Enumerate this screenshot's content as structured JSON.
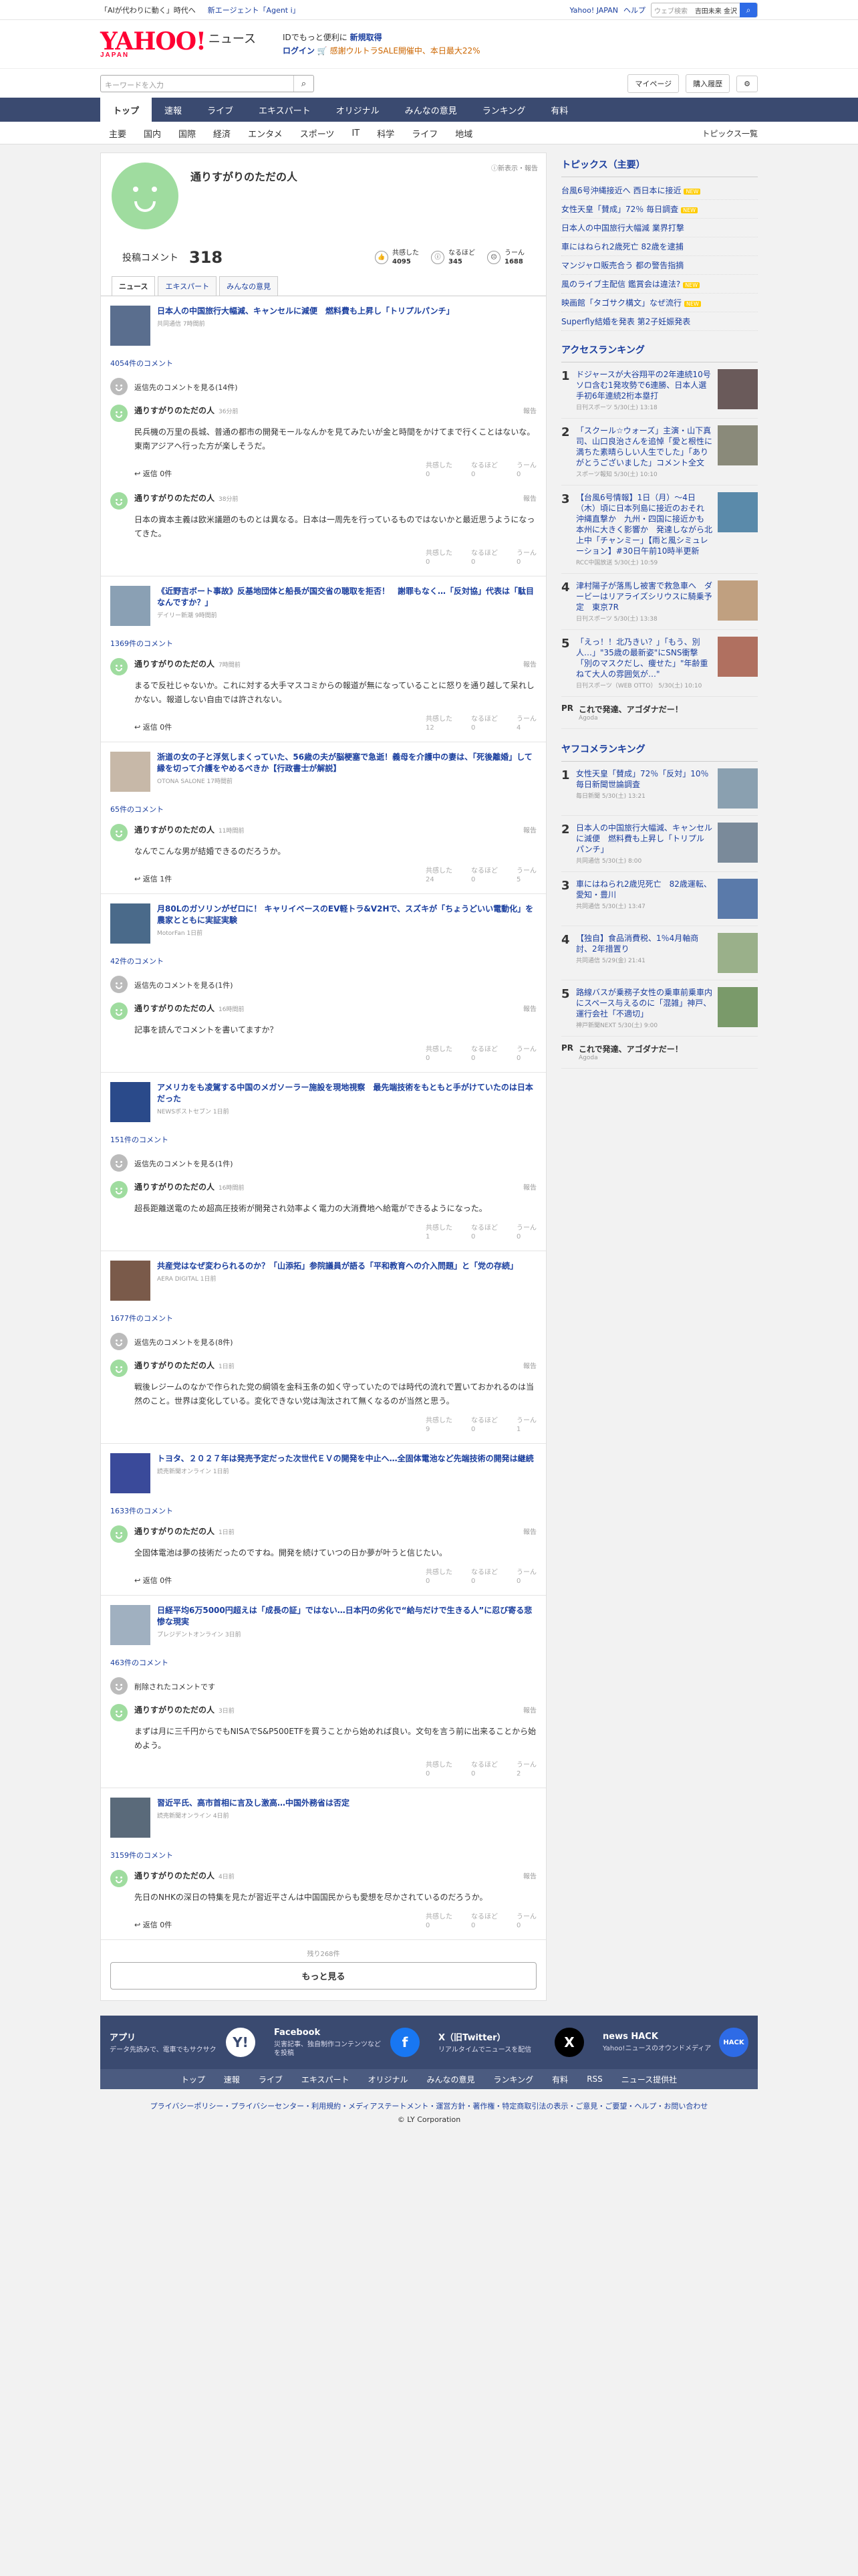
{
  "topbar": {
    "promo1": "「AIが代わりに動く」時代へ",
    "promo2": "新エージェント「Agent i」",
    "links": [
      "Yahoo! JAPAN",
      "ヘルプ"
    ],
    "search_placeholder": "ウェブ検索",
    "location": "吉田未来 金沢"
  },
  "header": {
    "logo": "YAHOO!",
    "logo_sub": "JAPAN",
    "logo_section": "ニュース",
    "promo_line1_a": "IDでもっと便利に",
    "promo_line1_b": "新規取得",
    "promo_line2_a": "ログイン",
    "promo_line2_b": "🛒 感謝ウルトラSALE開催中、本日最大22%"
  },
  "search": {
    "placeholder": "キーワードを入力",
    "mypage": "マイページ",
    "history": "購入履歴"
  },
  "gnav": [
    "トップ",
    "速報",
    "ライブ",
    "エキスパート",
    "オリジナル",
    "みんなの意見",
    "ランキング",
    "有料"
  ],
  "subnav": [
    "主要",
    "国内",
    "国際",
    "経済",
    "エンタメ",
    "スポーツ",
    "IT",
    "科学",
    "ライフ",
    "地域"
  ],
  "subnav_more": "トピックス一覧",
  "profile": {
    "name": "通りすがりのただの人",
    "links": "ⓘ新表示・報告",
    "comments_label": "投稿コメント",
    "comments_count": "318",
    "stats": [
      {
        "label": "共感した",
        "value": "4095",
        "icon": "👍"
      },
      {
        "label": "なるほど",
        "value": "345",
        "icon": "ⓘ"
      },
      {
        "label": "うーん",
        "value": "1688",
        "icon": "☹"
      }
    ]
  },
  "tabs": [
    "ニュース",
    "エキスパート",
    "みんなの意見"
  ],
  "articles": [
    {
      "title": "日本人の中国旅行大幅減、キャンセルに減便　燃料費も上昇し「トリプルパンチ」",
      "source": "共同通信 7時間前",
      "comment_count": "4054件のコメント",
      "comments": [
        {
          "name": "通りすがりのただの人",
          "date": "36分前",
          "text": "民兵機の万里の長城、普通の都市の開発モールなんかを見てみたいが金と時間をかけてまで行くことはないな。東南アジアへ行った方が楽しそうだ。",
          "reply": "返信 0件",
          "a": "0",
          "b": "0",
          "c": "0"
        },
        {
          "name": "通りすがりのただの人",
          "date": "38分前",
          "text": "日本の資本主義は欧米議題のものとは異なる。日本は一周先を行っているものではないかと最近思うようになってきた。",
          "reply": "",
          "a": "0",
          "b": "0",
          "c": "0"
        }
      ],
      "hidden": "返信先のコメントを見る(14件)"
    },
    {
      "title": "《近野吉ボート事故》反基地団体と船長が国交省の聴取を拒否！　謝罪もなく…「反対協」代表は「駄目なんですか？」",
      "source": "デイリー新潮 9時間前",
      "comment_count": "1369件のコメント",
      "comments": [
        {
          "name": "通りすがりのただの人",
          "date": "7時間前",
          "text": "まるで反社じゃないか。これに対する大手マスコミからの報道が無になっていることに怒りを通り越して呆れしかない。報道しない自由では許されない。",
          "reply": "返信 0件",
          "a": "12",
          "b": "0",
          "c": "4"
        }
      ],
      "hidden": ""
    },
    {
      "title": "浙道の女の子と浮気しまくっていた、56歳の夫が脳梗塞で急逝！義母を介護中の妻は、「死後離婚」して縁を切って介護をやめるべきか【行政書士が解説】",
      "source": "OTONA SALONE 17時間前",
      "comment_count": "65件のコメント",
      "comments": [
        {
          "name": "通りすがりのただの人",
          "date": "11時間前",
          "text": "なんでこんな男が結婚できるのだろうか。",
          "reply": "返信 1件",
          "a": "24",
          "b": "0",
          "c": "5"
        }
      ],
      "hidden": ""
    },
    {
      "title": "月80Lのガソリンがゼロに！ キャリイベースのEV軽トラ&V2Hで、スズキが「ちょうどいい電動化」を農家とともに実証実験",
      "source": "MotorFan 1日前",
      "comment_count": "42件のコメント",
      "comments": [
        {
          "name": "通りすがりのただの人",
          "date": "16時間前",
          "text": "記事を読んでコメントを書いてますか？",
          "reply": "",
          "a": "0",
          "b": "0",
          "c": "0"
        }
      ],
      "hidden": "返信先のコメントを見る(1件)"
    },
    {
      "title": "アメリカをも凌駕する中国のメガソーラー施設を現地視察　最先端技術をもともと手がけていたのは日本だった",
      "source": "NEWSポストセブン 1日前",
      "comment_count": "151件のコメント",
      "comments": [
        {
          "name": "通りすがりのただの人",
          "date": "16時間前",
          "text": "超長距離送電のため超高圧技術が開発され効率よく電力の大消費地へ給電ができるようになった。",
          "reply": "",
          "a": "1",
          "b": "0",
          "c": "0"
        }
      ],
      "hidden": "返信先のコメントを見る(1件)"
    },
    {
      "title": "共産党はなぜ変わられるのか？「山添拓」参院議員が語る「平和教育への介入問題」と「党の存続」",
      "source": "AERA DIGITAL 1日前",
      "comment_count": "1677件のコメント",
      "comments": [
        {
          "name": "通りすがりのただの人",
          "date": "1日前",
          "text": "戦後レジームのなかで作られた党の綱領を金科玉条の如く守っていたのでは時代の流れで置いておかれるのは当然のこと。世界は変化している。変化できない党は淘汰されて無くなるのが当然と思う。",
          "reply": "",
          "a": "9",
          "b": "0",
          "c": "1"
        }
      ],
      "hidden": "返信先のコメントを見る(8件)"
    },
    {
      "title": "トヨタ、２０２７年は発売予定だった次世代ＥＶの開発を中止へ…全固体電池など先端技術の開発は継続",
      "source": "読売新聞オンライン 1日前",
      "comment_count": "1633件のコメント",
      "comments": [
        {
          "name": "通りすがりのただの人",
          "date": "1日前",
          "text": "全固体電池は夢の技術だったのですね。開発を続けていつの日か夢が叶うと信じたい。",
          "reply": "返信 0件",
          "a": "0",
          "b": "0",
          "c": "0"
        }
      ],
      "hidden": ""
    },
    {
      "title": "日経平均6万5000円超えは「成長の証」ではない…日本円の劣化で“給与だけで生きる人”に忍び寄る悲惨な現実",
      "source": "プレジデントオンライン 3日前",
      "comment_count": "463件のコメント",
      "comments": [
        {
          "name": "通りすがりのただの人",
          "date": "3日前",
          "text": "まずは月に三千円からでもNISAでS&P500ETFを買うことから始めれば良い。文句を言う前に出来ることから始めよう。",
          "reply": "",
          "a": "0",
          "b": "0",
          "c": "2"
        }
      ],
      "hidden": "削除されたコメントです"
    },
    {
      "title": "習近平氏、高市首相に言及し激高…中国外務省は否定",
      "source": "読売新聞オンライン 4日前",
      "comment_count": "3159件のコメント",
      "comments": [
        {
          "name": "通りすがりのただの人",
          "date": "4日前",
          "text": "先日のNHKの深日の特集を見たが習近平さんは中国国民からも愛想を尽かされているのだろうか。",
          "reply": "返信 0件",
          "a": "0",
          "b": "0",
          "c": "0"
        }
      ],
      "hidden": ""
    }
  ],
  "reaction_labels": [
    "共感した",
    "なるほど",
    "うーん"
  ],
  "report": "報告",
  "remaining": "残り268件",
  "more_button": "もっと見る",
  "side": {
    "topics_title": "トピックス（主要）",
    "topics": [
      "台風6号沖縄接近へ 西日本に接近",
      "女性天皇「賛成」72％ 毎日調査",
      "日本人の中国旅行大幅減 業界打撃",
      "車にはねられ2歳死亡 82歳を逮捕",
      "マンジャロ販売合う 都の警告指摘",
      "風のライブ主配信 鑑賞会は違法?",
      "映画館「タゴサク構文」なぜ流行",
      "Superfly結婚を発表 第2子妊娠発表"
    ],
    "new_label": "NEW",
    "access_title": "アクセスランキング",
    "access": [
      {
        "no": "1",
        "title": "ドジャースが大谷翔平の2年連続10号ソロ含む1発攻勢で6連勝、日本人選手初6年連続2桁本塁打",
        "meta": "日刊スポーツ 5/30(土) 13:18"
      },
      {
        "no": "2",
        "title": "「スクール☆ウォーズ」主演・山下真司、山口良治さんを追悼「愛と根性に満ちた素晴らしい人生でした」「ありがとうございました」コメント全文",
        "meta": "スポーツ報知 5/30(土) 10:10"
      },
      {
        "no": "3",
        "title": "【台風6号情報】1日（月）～4日（木）頃に日本列島に接近のおそれ 沖縄直撃か　九州・四国に接近かも　本州に大きく影響か　発達しながら北上中「チャンミー」【雨と風シミュレーション】#30日午前10時半更新",
        "meta": "RCC中国放送 5/30(土) 10:59"
      },
      {
        "no": "4",
        "title": "津村陽子が落馬し被害で救急車へ　ダービーはリアライズシリウスに騎乗予定　東京7R",
        "meta": "日刊スポーツ 5/30(土) 13:38"
      },
      {
        "no": "5",
        "title": "「えっ！！北乃きい？」「もう、別人…」\"35歳の最新姿\"にSNS衝撃「別のマスクだし、痩せた」\"年齢重ねて大人の雰囲気が…\"",
        "meta": "日刊スポーツ（WEB OTTO） 5/30(土) 10:10"
      }
    ],
    "ad1_title": "これで発達、アゴダナだー！",
    "ad1_meta": "Agoda",
    "yafuko_title": "ヤフコメランキング",
    "yafuko": [
      {
        "no": "1",
        "title": "女性天皇「賛成」72％「反対」10％　毎日新聞世論調査",
        "meta": "毎日新聞 5/30(土) 13:21"
      },
      {
        "no": "2",
        "title": "日本人の中国旅行大幅減、キャンセルに減便　燃料費も上昇し「トリプルパンチ」",
        "meta": "共同通信 5/30(土) 8:00"
      },
      {
        "no": "3",
        "title": "車にはねられ2歳児死亡　82歳運転、愛知・豊川",
        "meta": "共同通信 5/30(土) 13:47"
      },
      {
        "no": "4",
        "title": "【独自】食品消費税、1％4月軸商討、2年措置り",
        "meta": "共同通信 5/29(金) 21:41"
      },
      {
        "no": "5",
        "title": "路線バスが乗務子女性の乗車前乗車内にスペース与えるのに「混雑」神戸、運行会社「不適切」",
        "meta": "神戸新聞NEXT 5/30(土) 9:00"
      }
    ],
    "ad2_title": "これで発達、アゴダナだー！",
    "ad2_meta": "Agoda"
  },
  "footer": {
    "apps": [
      {
        "title": "アプリ",
        "desc": "データ先読みで、電車でもサクサク",
        "icon": "Y!"
      },
      {
        "title": "Facebook",
        "desc": "災害記事、独自制作コンテンツなどを投稿",
        "icon": "f"
      },
      {
        "title": "X（旧Twitter）",
        "desc": "リアルタイムでニュースを配信",
        "icon": "X"
      },
      {
        "title": "news HACK",
        "desc": "Yahoo!ニュースのオウンドメディア",
        "icon": "HACK"
      }
    ],
    "links": [
      "トップ",
      "速報",
      "ライブ",
      "エキスパート",
      "オリジナル",
      "みんなの意見",
      "ランキング",
      "有料",
      "RSS",
      "ニュース提供社"
    ],
    "legal": "プライバシーポリシー・プライバシーセンター・利用規約・メディアステートメント・運営方針・著作権・特定商取引法の表示・ご意見・ご要望・ヘルプ・お問い合わせ",
    "copyright": "© LY Corporation"
  },
  "colors": {
    "nav": "#3a4a70",
    "link": "#1a3e9e",
    "avatar": "#9fdc9f",
    "search": "#2e6be6"
  }
}
